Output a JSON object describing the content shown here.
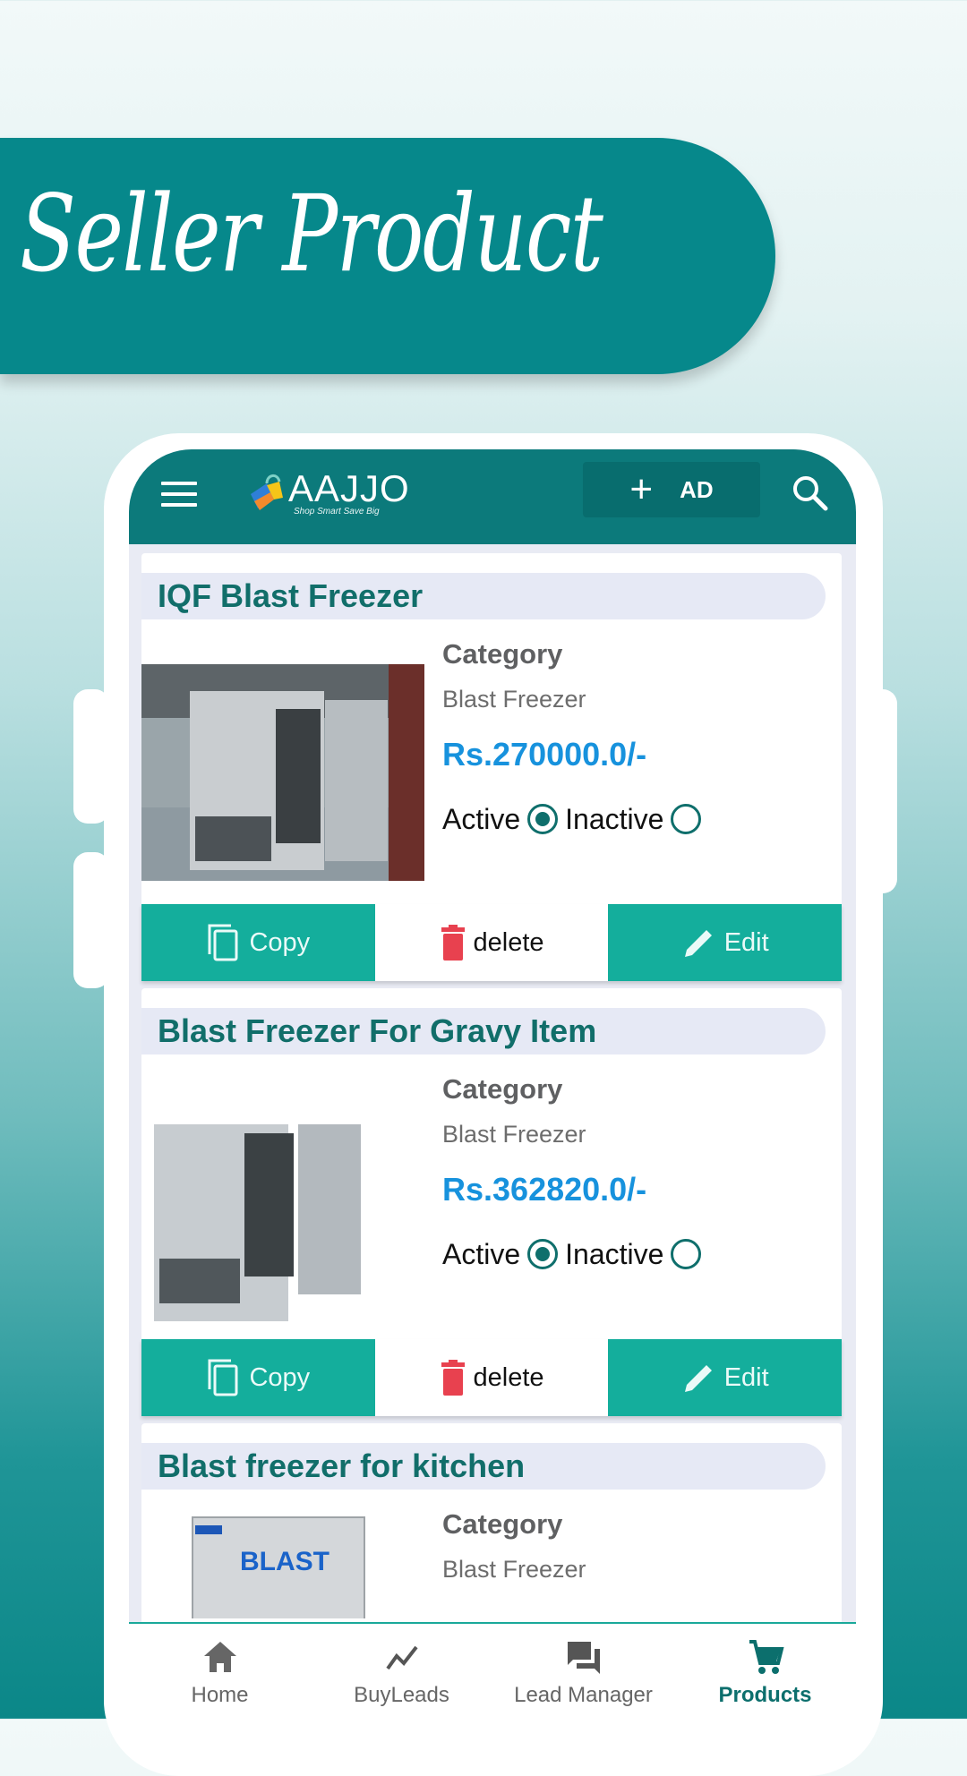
{
  "banner": {
    "title": "Seller Product"
  },
  "app": {
    "brand": "AAJJO",
    "tagline": "Shop Smart Save Big",
    "ad_button": {
      "icon": "plus-icon",
      "label": "AD"
    },
    "search_icon": "search-icon",
    "menu_icon": "hamburger-menu-icon"
  },
  "colors": {
    "appbar": "#0c7a7b",
    "accent_teal": "#14ae9c",
    "price_blue": "#1792dd",
    "delete_red": "#e8414f",
    "title_green": "#116e6a"
  },
  "products": [
    {
      "title": "IQF Blast Freezer",
      "category_label": "Category",
      "category": "Blast Freezer",
      "price": "Rs.270000.0/-",
      "active_label": "Active",
      "inactive_label": "Inactive",
      "status": "active",
      "actions": {
        "copy": "Copy",
        "delete": "delete",
        "edit": "Edit"
      }
    },
    {
      "title": "Blast Freezer For Gravy Item",
      "category_label": "Category",
      "category": "Blast Freezer",
      "price": "Rs.362820.0/-",
      "active_label": "Active",
      "inactive_label": "Inactive",
      "status": "active",
      "actions": {
        "copy": "Copy",
        "delete": "delete",
        "edit": "Edit"
      }
    },
    {
      "title": "Blast freezer for kitchen",
      "category_label": "Category",
      "category": "Blast Freezer",
      "image_text": "BLAST"
    }
  ],
  "bottom_nav": [
    {
      "label": "Home",
      "icon": "home-icon",
      "active": false
    },
    {
      "label": "BuyLeads",
      "icon": "trend-line-icon",
      "active": false
    },
    {
      "label": "Lead Manager",
      "icon": "chat-bubbles-icon",
      "active": false
    },
    {
      "label": "Products",
      "icon": "cart-icon",
      "active": true
    }
  ]
}
